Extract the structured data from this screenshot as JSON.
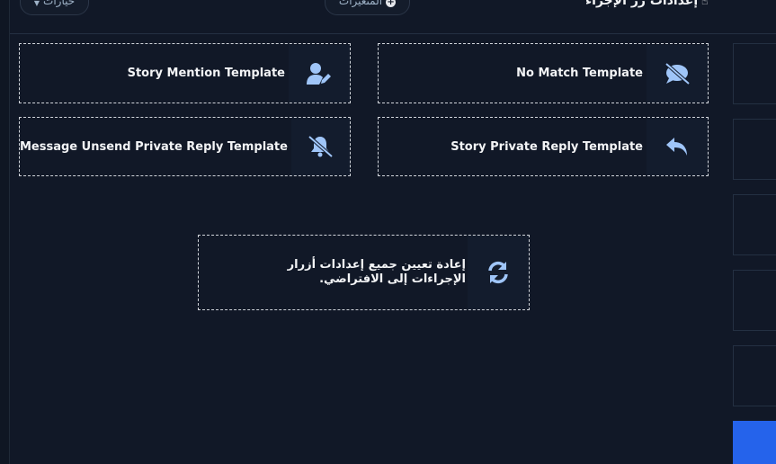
{
  "header": {
    "options_label": "خيارات",
    "variables_label": "المتغيرات",
    "title": "إعدادات زر الإجراء"
  },
  "cards": {
    "story_mention": "Story Mention Template",
    "no_match": "No Match Template",
    "message_unsend": "Message Unsend Private Reply Template",
    "story_private_reply": "Story Private Reply Template"
  },
  "reset": {
    "label": "إعادة تعيين جميع إعدادات أزرار الإجراءات إلى الافتراضي."
  },
  "colors": {
    "background": "#111827",
    "accent_icon": "#9fc5f8",
    "primary": "#2563eb"
  },
  "icons": {
    "story_mention": "user-pen-icon",
    "no_match": "comment-slash-icon",
    "message_unsend": "bell-slash-icon",
    "story_private_reply": "reply-icon",
    "reset": "sync-icon"
  }
}
